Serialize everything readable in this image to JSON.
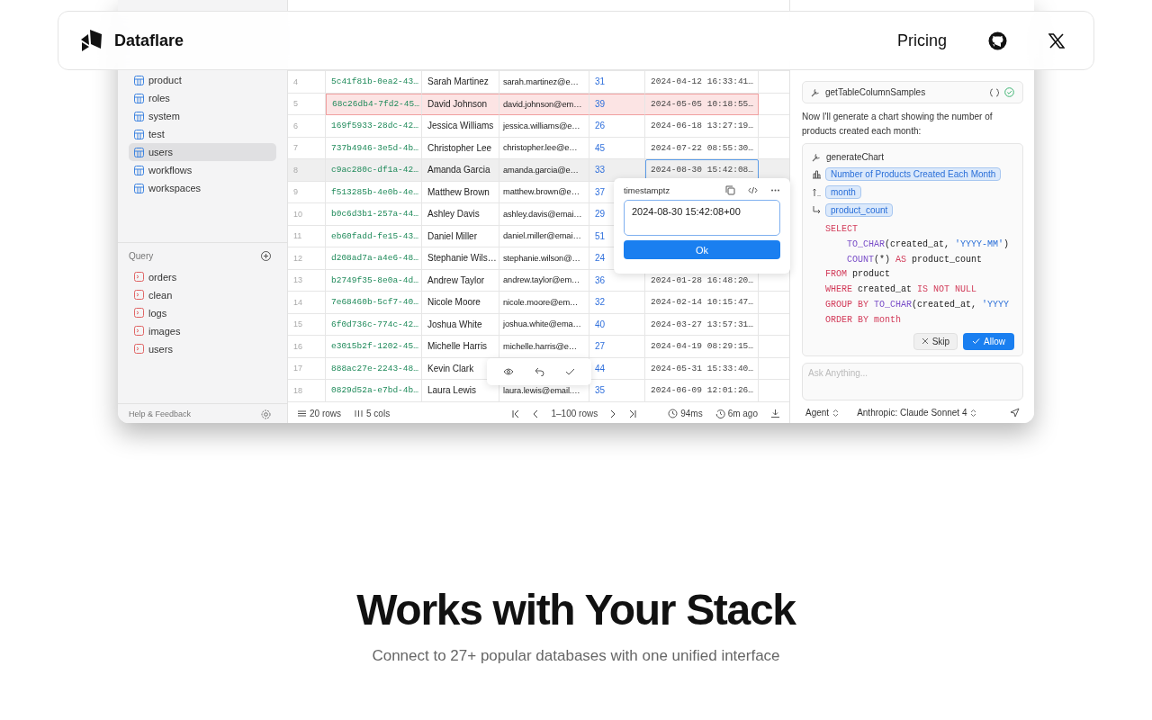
{
  "nav": {
    "brand": "Dataflare",
    "links": [
      {
        "label": "Pricing"
      }
    ]
  },
  "app": {
    "sidebar": {
      "tables": [
        {
          "name": "product",
          "selected": false
        },
        {
          "name": "roles",
          "selected": false
        },
        {
          "name": "system",
          "selected": false
        },
        {
          "name": "test",
          "selected": false
        },
        {
          "name": "users",
          "selected": true
        },
        {
          "name": "workflows",
          "selected": false
        },
        {
          "name": "workspaces",
          "selected": false
        }
      ],
      "query_title": "Query",
      "queries": [
        "orders",
        "clean",
        "logs",
        "images",
        "users"
      ],
      "footer": "Help & Feedback"
    },
    "grid": {
      "rows": [
        {
          "index": "4",
          "id": "5c41f81b-0ea2-43…",
          "name": "Sarah Martinez",
          "email": "sarah.martinez@e…",
          "age": "31",
          "created": "2024-04-12 16:33:41…",
          "selected": false,
          "flagged": false,
          "editing": false
        },
        {
          "index": "5",
          "id": "68c26db4-7fd2-45…",
          "name": "David Johnson",
          "email": "david.johnson@em…",
          "age": "39",
          "created": "2024-05-05 10:18:55…",
          "selected": false,
          "flagged": true,
          "editing": false
        },
        {
          "index": "6",
          "id": "169f5933-28dc-42…",
          "name": "Jessica Williams",
          "email": "jessica.williams@e…",
          "age": "26",
          "created": "2024-06-18 13:27:19…",
          "selected": false,
          "flagged": false,
          "editing": false
        },
        {
          "index": "7",
          "id": "737b4946-3e5d-4b…",
          "name": "Christopher Lee",
          "email": "christopher.lee@e…",
          "age": "45",
          "created": "2024-07-22 08:55:30…",
          "selected": false,
          "flagged": false,
          "editing": false
        },
        {
          "index": "8",
          "id": "c9ac280c-df1a-42…",
          "name": "Amanda Garcia",
          "email": "amanda.garcia@e…",
          "age": "33",
          "created": "2024-08-30 15:42:08…",
          "selected": true,
          "flagged": false,
          "editing": true
        },
        {
          "index": "9",
          "id": "f513285b-4e0b-4e…",
          "name": "Matthew Brown",
          "email": "matthew.brown@e…",
          "age": "37",
          "selected": false,
          "flagged": false
        },
        {
          "index": "10",
          "id": "b0c6d3b1-257a-44…",
          "name": "Ashley Davis",
          "email": "ashley.davis@emai…",
          "age": "29",
          "selected": false,
          "flagged": false
        },
        {
          "index": "11",
          "id": "eb60fadd-fe15-43…",
          "name": "Daniel Miller",
          "email": "daniel.miller@emai…",
          "age": "51",
          "selected": false,
          "flagged": false
        },
        {
          "index": "12",
          "id": "d208ad7a-a4e6-48…",
          "name": "Stephanie Wils…",
          "email": "stephanie.wilson@…",
          "age": "24",
          "selected": false,
          "flagged": false
        },
        {
          "index": "13",
          "id": "b2749f35-8e0a-4d…",
          "name": "Andrew Taylor",
          "email": "andrew.taylor@em…",
          "age": "36",
          "created": "2024-01-28 16:48:20…",
          "selected": false,
          "flagged": false,
          "editing": false
        },
        {
          "index": "14",
          "id": "7e68460b-5cf7-40…",
          "name": "Nicole Moore",
          "email": "nicole.moore@em…",
          "age": "32",
          "created": "2024-02-14 10:15:47…",
          "selected": false,
          "flagged": false,
          "editing": false
        },
        {
          "index": "15",
          "id": "6f0d736c-774c-42…",
          "name": "Joshua White",
          "email": "joshua.white@ema…",
          "age": "40",
          "created": "2024-03-27 13:57:31…",
          "selected": false,
          "flagged": false,
          "editing": false
        },
        {
          "index": "16",
          "id": "e3015b2f-1202-45…",
          "name": "Michelle Harris",
          "email": "michelle.harris@e…",
          "age": "27",
          "created": "2024-04-19 08:29:15…",
          "selected": false,
          "flagged": false,
          "editing": false
        },
        {
          "index": "17",
          "id": "888ac27e-2243-48…",
          "name": "Kevin Clark",
          "age": "44",
          "created": "2024-05-31 15:33:40…",
          "selected": false,
          "flagged": false,
          "editing": false
        },
        {
          "index": "18",
          "id": "0829d52a-e7bd-4b…",
          "name": "Laura Lewis",
          "email": "laura.lewis@email.…",
          "age": "35",
          "created": "2024-06-09 12:01:26…",
          "selected": false,
          "flagged": false,
          "editing": false
        }
      ],
      "editor": {
        "type_label": "timestamptz",
        "value": "2024-08-30 15:42:08+00",
        "button": "Ok"
      },
      "footer": {
        "rows": "20 rows",
        "cols": "5 cols",
        "range": "1–100 rows",
        "time": "94ms",
        "ago": "6m ago"
      }
    },
    "chat": {
      "items": [
        {
          "kind": "tool",
          "name": "getTableColumnSamples",
          "done": true
        },
        {
          "kind": "message",
          "text": "Now I'll generate a chart showing the number of products created each month:"
        },
        {
          "kind": "chart_tool",
          "name": "generateChart",
          "title": "Number of Products Created Each Month",
          "x": "month",
          "y": "product_count",
          "sql": [
            {
              "kind": "clause",
              "tokens": [
                {
                  "kind": "keyword",
                  "text": "SELECT"
                }
              ]
            },
            {
              "kind": "continuation",
              "tokens": [
                {
                  "kind": "function",
                  "text": "TO_CHAR"
                },
                {
                  "kind": "plain",
                  "text": "(created_at, "
                },
                {
                  "kind": "string",
                  "text": "'YYYY-MM'"
                },
                {
                  "kind": "plain",
                  "text": ")"
                }
              ]
            },
            {
              "kind": "continuation",
              "tokens": [
                {
                  "kind": "function",
                  "text": "COUNT"
                },
                {
                  "kind": "plain",
                  "text": "(*) "
                },
                {
                  "kind": "keyword",
                  "text": "AS"
                },
                {
                  "kind": "plain",
                  "text": " product_count"
                }
              ]
            },
            {
              "kind": "clause",
              "tokens": [
                {
                  "kind": "keyword",
                  "text": "FROM"
                },
                {
                  "kind": "plain",
                  "text": " product"
                }
              ]
            },
            {
              "kind": "clause",
              "tokens": [
                {
                  "kind": "keyword",
                  "text": "WHERE"
                },
                {
                  "kind": "plain",
                  "text": " created_at "
                },
                {
                  "kind": "keyword",
                  "text": "IS NOT NULL"
                }
              ]
            },
            {
              "kind": "clause",
              "tokens": [
                {
                  "kind": "keyword",
                  "text": "GROUP BY "
                },
                {
                  "kind": "function",
                  "text": "TO_CHAR"
                },
                {
                  "kind": "plain",
                  "text": "(created_at, "
                },
                {
                  "kind": "string",
                  "text": "'YYYY"
                }
              ]
            },
            {
              "kind": "clause",
              "tokens": [
                {
                  "kind": "keyword",
                  "text": "ORDER BY month"
                }
              ]
            }
          ],
          "skip": "Skip",
          "allow": "Allow"
        }
      ],
      "placeholder": "Ask Anything...",
      "mode": "Agent",
      "model": "Anthropic: Claude Sonnet 4"
    }
  },
  "hero": {
    "title": "Works with Your Stack",
    "subtitle": "Connect to 27+ popular databases with one unified interface"
  }
}
